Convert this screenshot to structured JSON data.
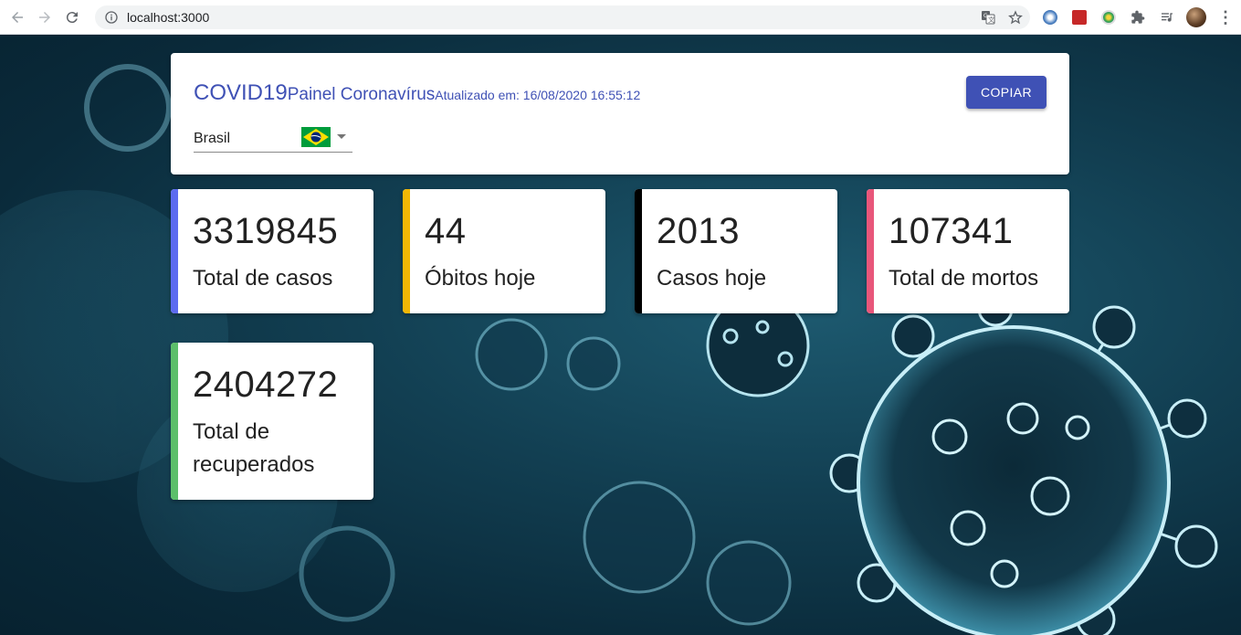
{
  "browser": {
    "url": "localhost:3000",
    "icons": [
      "back-arrow-icon",
      "forward-arrow-icon",
      "reload-icon",
      "site-info-icon",
      "translate-icon",
      "bookmark-star-icon",
      "extension-icon",
      "puzzle-icon",
      "media-queue-icon",
      "profile-avatar",
      "menu-kebab-icon"
    ]
  },
  "header": {
    "title_main": "COVID19",
    "title_sub": "Painel Coronavírus",
    "updated": "Atualizado em: 16/08/2020 16:55:12",
    "copy_button": "COPIAR",
    "country": "Brasil"
  },
  "stats": [
    {
      "value": "3319845",
      "label": "Total de casos",
      "color": "#5c6bf0"
    },
    {
      "value": "44",
      "label": "Óbitos hoje",
      "color": "#f2b705"
    },
    {
      "value": "2013",
      "label": "Casos hoje",
      "color": "#000000"
    },
    {
      "value": "107341",
      "label": "Total de mortos",
      "color": "#e8567a"
    },
    {
      "value": "2404272",
      "label": "Total de recuperados",
      "color": "#5cbf6a"
    }
  ],
  "colors": {
    "accent": "#3f51b5",
    "background": "#0b2f40"
  }
}
